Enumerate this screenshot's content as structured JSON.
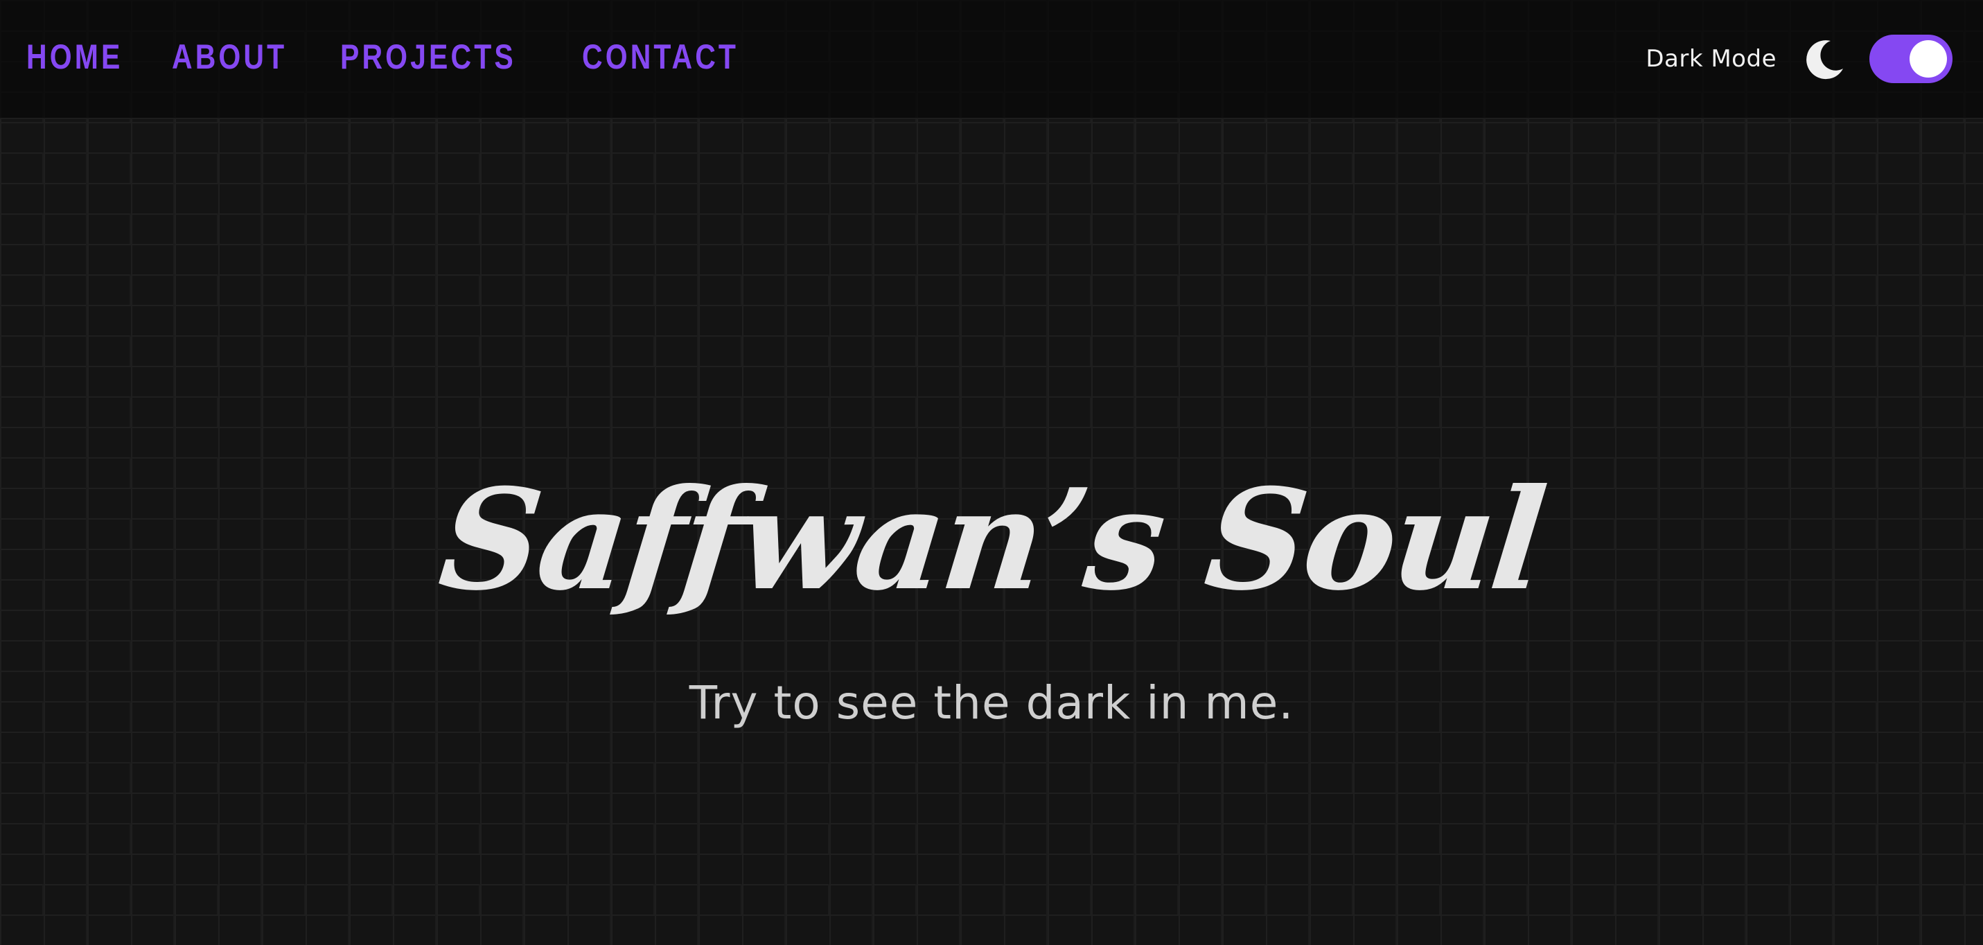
{
  "nav": {
    "links": [
      {
        "label": "HOME"
      },
      {
        "label": "ABOUT"
      },
      {
        "label": "PROJECTS"
      },
      {
        "label": "CONTACT"
      }
    ]
  },
  "mode_toggle": {
    "label": "Dark Mode",
    "icon": "moon-icon",
    "enabled": true
  },
  "hero": {
    "title": "Saffwan’s Soul",
    "subtitle": "Try to see the dark in me."
  },
  "colors": {
    "accent": "#8548f2",
    "background": "#141414",
    "text": "#e6e6e6"
  }
}
